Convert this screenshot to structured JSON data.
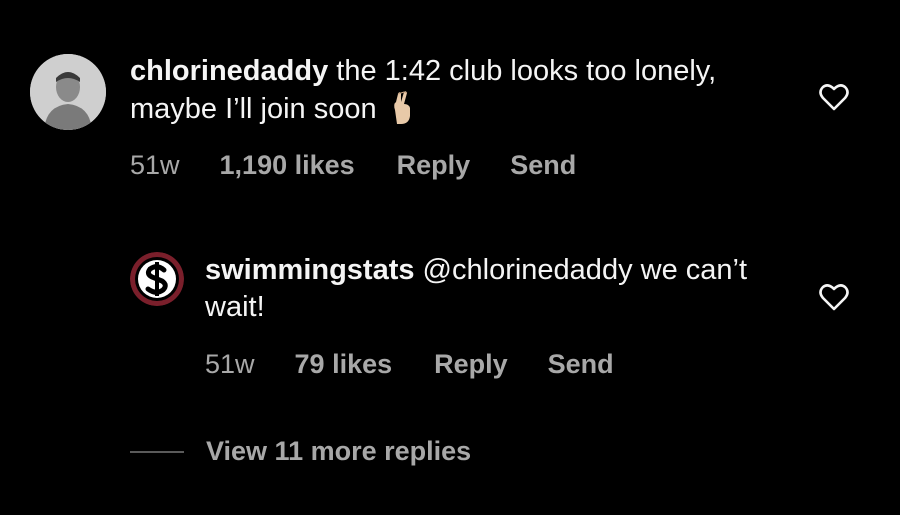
{
  "comment": {
    "username": "chlorinedaddy",
    "text": " the 1:42 club looks too lonely, maybe I’ll join soon",
    "emoji": "crossed-fingers-emoji",
    "time": "51w",
    "likes": "1,190 likes",
    "reply_label": "Reply",
    "send_label": "Send"
  },
  "reply": {
    "username": "swimmingstats",
    "text": " @chlorinedaddy we can’t wait!",
    "avatar_icon": "dollar-s-logo",
    "time": "51w",
    "likes": "79 likes",
    "reply_label": "Reply",
    "send_label": "Send"
  },
  "view_more": {
    "label": "View 11 more replies"
  },
  "colors": {
    "background": "#000000",
    "text": "#f5f5f5",
    "muted": "#a8a8a8",
    "logo_red": "#7a1f2b"
  }
}
